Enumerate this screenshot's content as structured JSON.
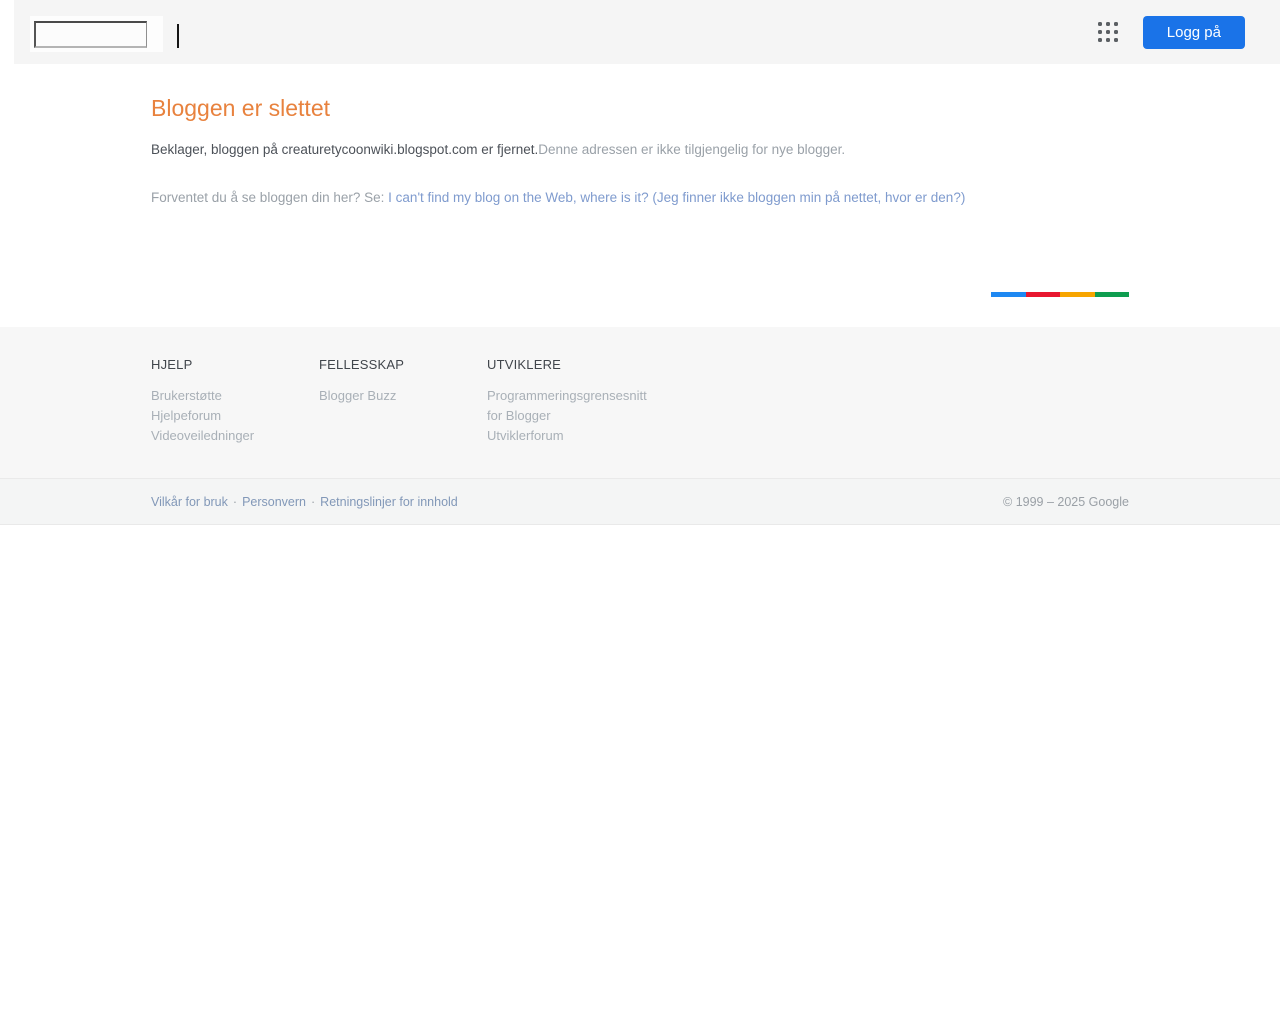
{
  "header": {
    "signin_label": "Logg på"
  },
  "main": {
    "title": "Bloggen er slettet",
    "message_strong": "Beklager, bloggen på creaturetycoonwiki.blogspot.com er fjernet.",
    "message_rest": "Denne adressen er ikke tilgjengelig for nye blogger.",
    "help_prompt": "Forventet du å se bloggen din her? Se: ",
    "help_link": "I can't find my blog on the Web, where is it? (Jeg finner ikke bloggen min på nettet, hvor er den?)"
  },
  "footer": {
    "columns": [
      {
        "heading": "HJELP",
        "links": [
          "Brukerstøtte",
          "Hjelpeforum",
          "Videoveiledninger"
        ]
      },
      {
        "heading": "FELLESSKAP",
        "links": [
          "Blogger Buzz"
        ]
      },
      {
        "heading": "UTVIKLERE",
        "links": [
          "Programmeringsgrensesnitt for Blogger",
          "Utviklerforum"
        ]
      }
    ],
    "separator": "·",
    "legal_links": [
      "Vilkår for bruk",
      "Personvern",
      "Retningslinjer for innhold"
    ],
    "copyright": "© 1999 – 2025 Google"
  },
  "colors": {
    "accent_blue": "#1a73e8",
    "title_orange": "#e8823e",
    "rainbow": [
      "#1e88f2",
      "#e8172f",
      "#f7a500",
      "#0e9d4f"
    ]
  }
}
